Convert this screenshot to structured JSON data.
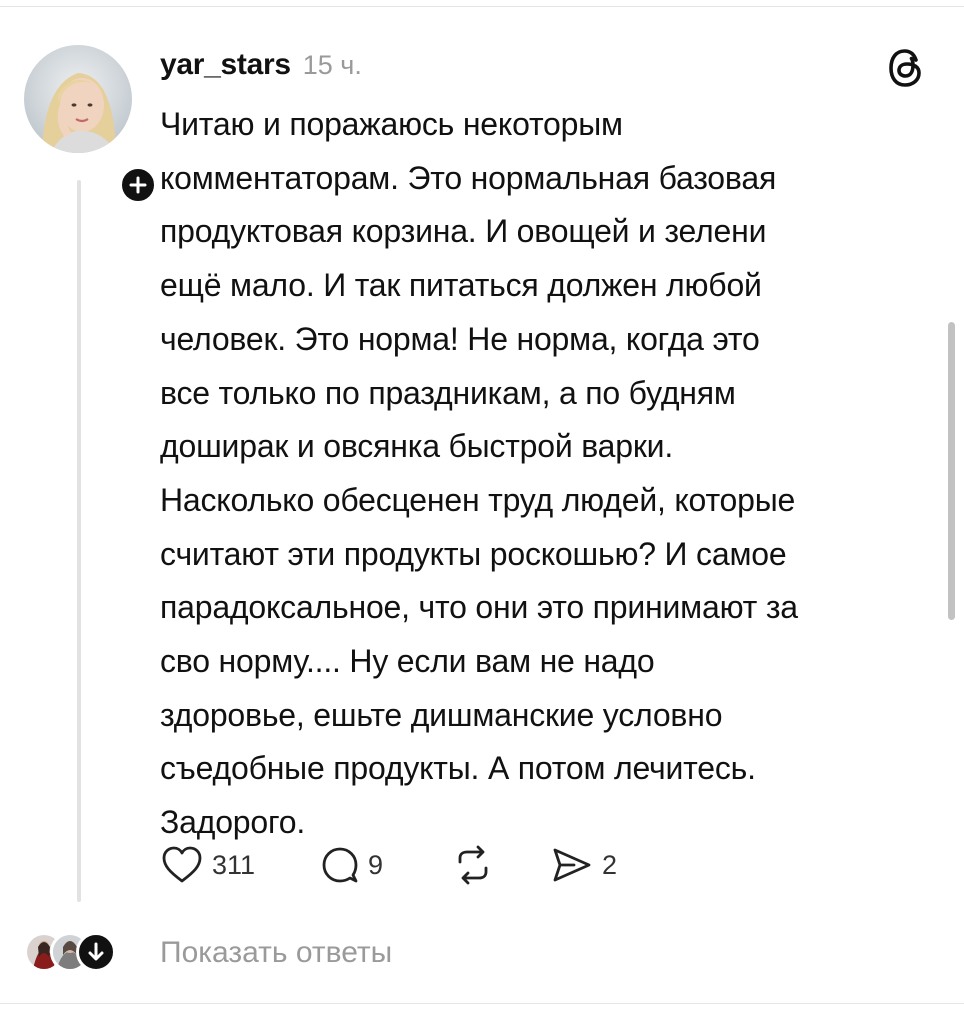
{
  "post": {
    "username": "yar_stars",
    "time": "15 ч.",
    "text": "Читаю и поражаюсь некоторым\nкомментаторам. Это нормальная базовая\nпродуктовая корзина. И овощей и зелени\nещё мало. И так питаться должен любой\nчеловек. Это норма! Не норма, когда это\nвсе только по праздникам, а по будням\nдоширак и овсянка быстрой варки.\nНасколько обесценен труд людей, которые\nсчитают эти продукты роскошью? И самое\nпарадоксальное, что они это принимают за\nсво норму.... Ну если вам не надо\nздоровье, ешьте дишманские условно\nсъедобные продукты. А потом лечитесь.\nЗадорого.",
    "likes": "311",
    "replies": "9",
    "shares": "2"
  },
  "thread": {
    "show_replies_label": "Показать ответы"
  },
  "colors": {
    "text": "#111111",
    "muted": "#9a9a9a",
    "divider": "#e6e6e6"
  },
  "icons": [
    "follow-plus-icon",
    "threads-logo-icon",
    "heart-icon",
    "comment-icon",
    "repost-icon",
    "share-icon",
    "chevron-down-icon"
  ]
}
